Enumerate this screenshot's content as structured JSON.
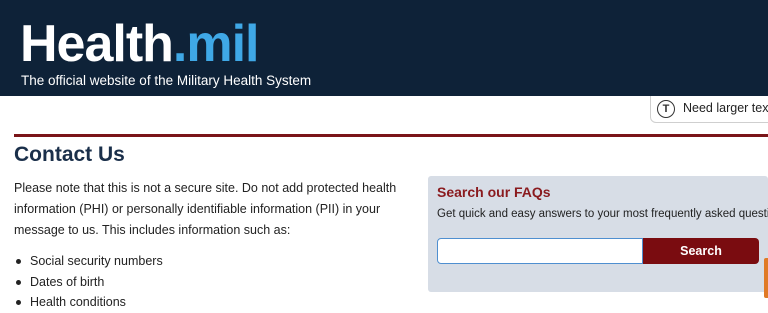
{
  "header": {
    "logo_part1": "Health",
    "logo_part2": ".mil",
    "tagline": "The official website of the Military Health System"
  },
  "accessibility": {
    "icon_glyph": "T",
    "label": "Need larger text?"
  },
  "page": {
    "title": "Contact Us",
    "intro": "Please note that this is not a secure site.  Do not add protected health information (PHI) or personally identifiable information (PII) in your message to us.  This includes information such as:",
    "bullets": [
      "Social security numbers",
      "Dates of birth",
      "Health conditions"
    ]
  },
  "faq": {
    "heading": "Search our FAQs",
    "description": "Get quick and easy answers to your most frequently asked questions.",
    "search_value": "",
    "search_button_label": "Search"
  },
  "colors": {
    "header_bg": "#0e2238",
    "logo_accent": "#3fa8e6",
    "rule": "#7a1418",
    "faq_heading": "#8a1a1e",
    "faq_bg": "#d7dde6",
    "search_button_bg": "#7a0c10"
  }
}
